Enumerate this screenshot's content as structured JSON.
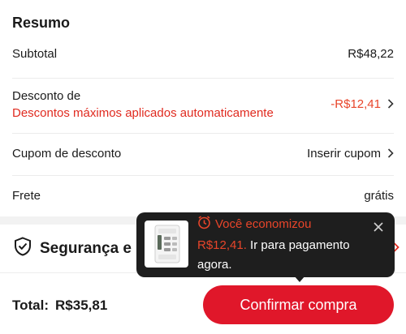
{
  "summary": {
    "title": "Resumo",
    "subtotal_label": "Subtotal",
    "subtotal_value": "R$48,22",
    "discount_label": "Desconto de",
    "discount_sub": "Descontos máximos aplicados automaticamente",
    "discount_value": "-R$12,41",
    "coupon_label": "Cupom de desconto",
    "coupon_value": "Inserir cupom",
    "shipping_label": "Frete",
    "shipping_value": "grátis"
  },
  "security": {
    "label": "Segurança e privacidade"
  },
  "bottom": {
    "total_label": "Total:",
    "total_value": "R$35,81",
    "confirm_label": "Confirmar compra"
  },
  "toast": {
    "title": "Você economizou",
    "saved_amount": "R$12,41.",
    "body_text": " Ir para pagamento agora."
  },
  "colors": {
    "accent": "#e0172a",
    "discount": "#e8452a",
    "toast_bg": "#1e1e1e"
  },
  "icons": {
    "security": "shield-check-icon",
    "toast_title": "alarm-clock-icon",
    "close": "close-icon",
    "chevron": "chevron-right-icon"
  }
}
